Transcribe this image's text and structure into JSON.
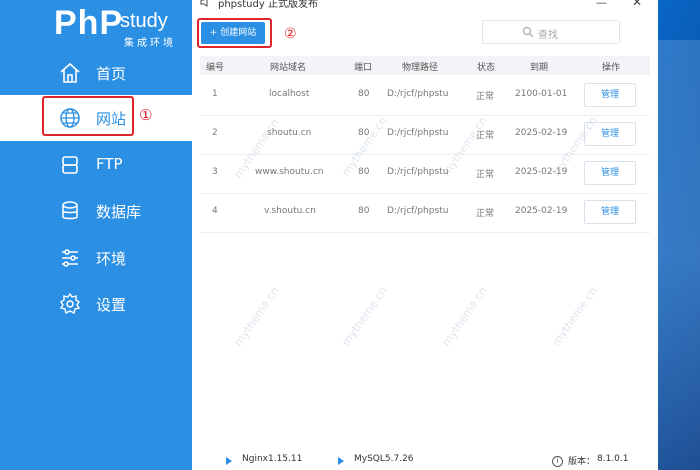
{
  "window": {
    "title": "phpstudy 正式版发布",
    "minimize_glyph": "—",
    "close_glyph": "✕"
  },
  "logo": {
    "brand": "PhP",
    "study": "study",
    "subtitle": "集成环境"
  },
  "sidebar": {
    "items": [
      {
        "label": "首页",
        "icon": "home-icon"
      },
      {
        "label": "网站",
        "icon": "globe-icon"
      },
      {
        "label": "FTP",
        "icon": "ftp-icon"
      },
      {
        "label": "数据库",
        "icon": "database-icon"
      },
      {
        "label": "环境",
        "icon": "sliders-icon"
      },
      {
        "label": "设置",
        "icon": "gear-icon"
      }
    ],
    "active": "网站",
    "annotation": "①"
  },
  "toolbar": {
    "create_label": "+ 创建网站",
    "annotation": "②",
    "search_placeholder": "查找"
  },
  "table": {
    "headers": [
      "编号",
      "网站域名",
      "端口",
      "物理路径",
      "状态",
      "到期",
      "操作"
    ],
    "rows": [
      {
        "id": "1",
        "domain": "localhost",
        "port": "80",
        "path": "D:/rjcf/phpstu",
        "status": "正常",
        "expires": "2100-01-01",
        "action": "管理"
      },
      {
        "id": "2",
        "domain": "shoutu.cn",
        "port": "80",
        "path": "D:/rjcf/phpstu",
        "status": "正常",
        "expires": "2025-02-19",
        "action": "管理"
      },
      {
        "id": "3",
        "domain": "www.shoutu.cn",
        "port": "80",
        "path": "D:/rjcf/phpstu",
        "status": "正常",
        "expires": "2025-02-19",
        "action": "管理"
      },
      {
        "id": "4",
        "domain": "v.shoutu.cn",
        "port": "80",
        "path": "D:/rjcf/phpstu",
        "status": "正常",
        "expires": "2025-02-19",
        "action": "管理"
      }
    ]
  },
  "footer": {
    "nginx": "Nginx1.15.11",
    "mysql": "MySQL5.7.26",
    "version_label": "版本：",
    "version": "8.1.0.1",
    "info_glyph": "i"
  },
  "watermark": "mytheme.cn",
  "colors": {
    "accent": "#2b8fe4",
    "annotation": "#e0242b"
  }
}
